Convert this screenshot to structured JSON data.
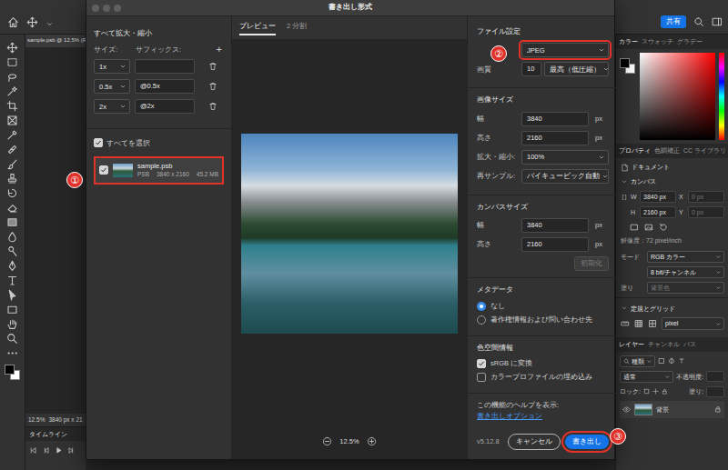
{
  "window": {
    "title": "書き出し形式"
  },
  "app": {
    "share_button": "共有",
    "document_tab": "sample.psb @ 12.5% (R",
    "status_zoom": "12.5%",
    "status_size": "3840 px x 21",
    "timeline_title": "タイムライン"
  },
  "color_panel": {
    "tabs": [
      {
        "label": "カラー",
        "selected": true
      },
      {
        "label": "スウォッチ",
        "selected": false
      },
      {
        "label": "グラデー",
        "selected": false
      }
    ]
  },
  "properties_panel": {
    "tabs": [
      {
        "label": "プロパティ",
        "selected": true
      },
      {
        "label": "色調補正",
        "selected": false
      },
      {
        "label": "CC ライブラリ",
        "selected": false
      }
    ],
    "section": "ドキュメント",
    "canvas_heading": "カンバス",
    "w_label": "W",
    "w_value": "3840 px",
    "x_label": "X",
    "x_value": "0 px",
    "h_label": "H",
    "h_value": "2160 px",
    "y_label": "Y",
    "y_value": "0 px",
    "resolution": "解像度：72 pixel/inch",
    "mode_label": "モード",
    "mode_value": "RGB カラー",
    "depth_value": "8 bit/チャンネル",
    "fill_label": "塗り",
    "fill_value": "背景色",
    "guides_heading": "定規とグリッド",
    "units_value": "pixel"
  },
  "layers_panel": {
    "tabs": [
      {
        "label": "レイヤー",
        "selected": true
      },
      {
        "label": "チャンネル",
        "selected": false
      },
      {
        "label": "パス",
        "selected": false
      }
    ],
    "filter_value": "種類",
    "blend_mode": "通常",
    "opacity_label": "不透明度:",
    "lock_label": "ロック:",
    "fill_label": "塗り:",
    "layers": [
      {
        "name": "背景",
        "visible": true,
        "locked": true
      }
    ]
  },
  "dialog": {
    "scale_all": {
      "heading": "すべて拡大・縮小",
      "size_label": "サイズ:",
      "suffix_label": "サフィックス:",
      "add": "+",
      "rows": [
        {
          "size": "1x",
          "suffix": ""
        },
        {
          "size": "0.5x",
          "suffix": "@0.5x"
        },
        {
          "size": "2x",
          "suffix": "@2x"
        }
      ]
    },
    "select_all": {
      "label": "すべてを選択",
      "checked": true
    },
    "assets": [
      {
        "name": "sample.psb",
        "type": "PSB",
        "dimensions": "3840 x 2160",
        "file_size": "45.2 MB",
        "checked": true,
        "selected": true
      }
    ],
    "preview": {
      "tabs": [
        {
          "label": "プレビュー",
          "selected": true
        },
        {
          "label": "2 分割",
          "selected": false
        }
      ],
      "zoom": "12.5%"
    },
    "file_settings": {
      "heading": "ファイル設定",
      "format": "JPEG",
      "quality_label": "画質",
      "quality": "10",
      "quality_preset": "最高（低圧縮）"
    },
    "image_size": {
      "heading": "画像サイズ",
      "width_label": "幅",
      "width": "3840",
      "width_unit": "px",
      "height_label": "高さ",
      "height": "2160",
      "height_unit": "px",
      "scale_label": "拡大・縮小:",
      "scale": "100%",
      "resample_label": "再サンプル:",
      "resample": "バイキュービック自動"
    },
    "canvas_size": {
      "heading": "カンバスサイズ",
      "width_label": "幅",
      "width": "3840",
      "width_unit": "px",
      "height_label": "高さ",
      "height": "2160",
      "height_unit": "px",
      "reset": {
        "label": "初期化",
        "disabled": true
      }
    },
    "metadata": {
      "heading": "メタデータ",
      "options": [
        {
          "label": "なし",
          "selected": true
        },
        {
          "label": "著作権情報および問い合わせ先",
          "selected": false
        }
      ]
    },
    "color_space": {
      "heading": "色空間情報",
      "options": [
        {
          "label": "sRGB に変換",
          "checked": true
        },
        {
          "label": "カラープロファイルの埋め込み",
          "checked": false
        }
      ]
    },
    "help": {
      "text": "この機能のヘルプを表示:",
      "link": "書き出しオプション"
    },
    "version": "v5.12.8",
    "cancel_button": "キャンセル",
    "export_button": "書き出し"
  },
  "callouts": {
    "asset": "①",
    "format": "②",
    "export": "③"
  }
}
